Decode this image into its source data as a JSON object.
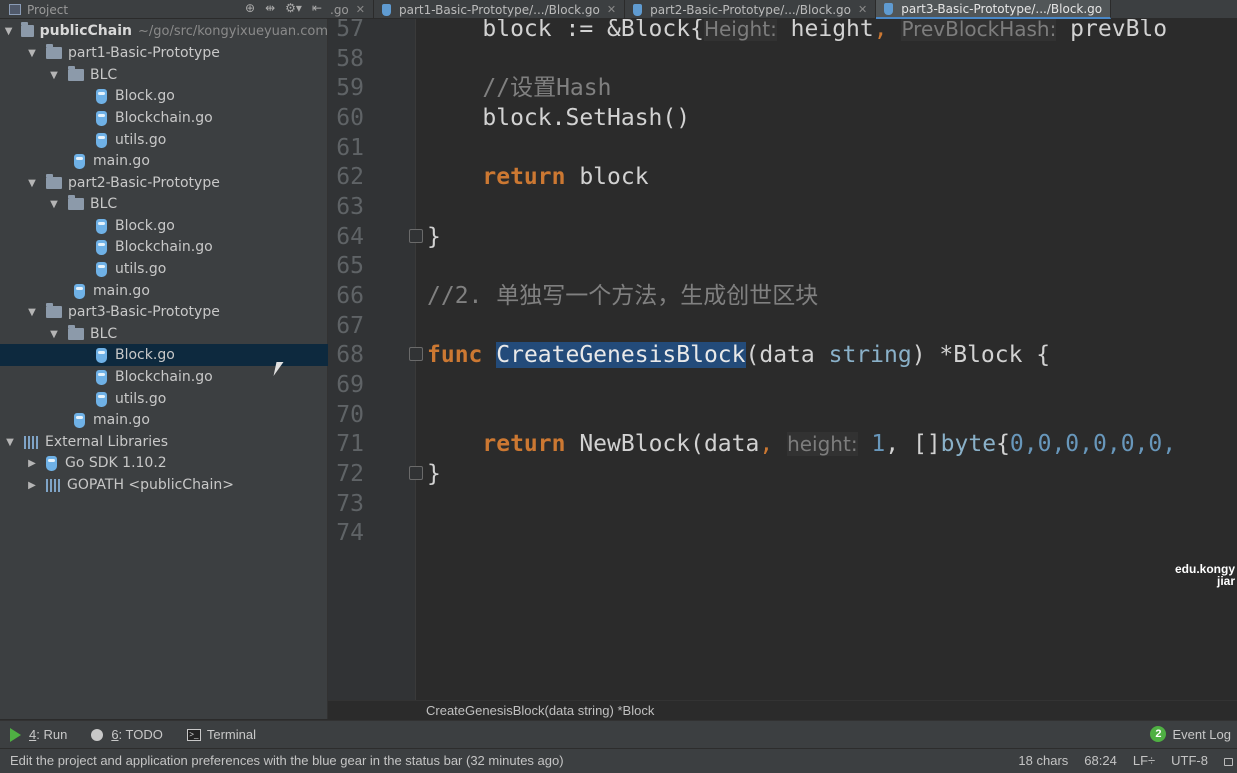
{
  "project_toolbar": {
    "title": "Project"
  },
  "tabs": [
    {
      "label": ".go",
      "partial": true,
      "closable": true
    },
    {
      "label": "part1-Basic-Prototype/.../Block.go",
      "closable": true
    },
    {
      "label": "part2-Basic-Prototype/.../Block.go",
      "closable": true
    },
    {
      "label": "part3-Basic-Prototype/.../Block.go",
      "closable": false,
      "active": true
    }
  ],
  "tree": {
    "root": {
      "label": "publicChain",
      "path": "~/go/src/kongyixueyuan.com"
    },
    "items": [
      {
        "label": "part1-Basic-Prototype"
      },
      {
        "label": "BLC"
      },
      {
        "label": "Block.go"
      },
      {
        "label": "Blockchain.go"
      },
      {
        "label": "utils.go"
      },
      {
        "label": "main.go"
      },
      {
        "label": "part2-Basic-Prototype"
      },
      {
        "label": "BLC"
      },
      {
        "label": "Block.go"
      },
      {
        "label": "Blockchain.go"
      },
      {
        "label": "utils.go"
      },
      {
        "label": "main.go"
      },
      {
        "label": "part3-Basic-Prototype"
      },
      {
        "label": "BLC"
      },
      {
        "label": "Block.go"
      },
      {
        "label": "Blockchain.go"
      },
      {
        "label": "utils.go"
      },
      {
        "label": "main.go"
      },
      {
        "label": "External Libraries"
      },
      {
        "label": "Go SDK 1.10.2"
      },
      {
        "label": "GOPATH <publicChain>"
      }
    ]
  },
  "editor": {
    "line_numbers": [
      "57",
      "58",
      "59",
      "60",
      "61",
      "62",
      "63",
      "64",
      "65",
      "66",
      "67",
      "68",
      "69",
      "70",
      "71",
      "72",
      "73",
      "74"
    ],
    "code": {
      "l57_a": "    block := &Block{",
      "l57_hint1": "Height:",
      "l57_b": " height",
      "l57_comma": ",",
      "l57_hint2": "PrevBlockHash:",
      "l57_c": " prevBlo",
      "l59": "    //设置Hash",
      "l60": "    block.SetHash()",
      "l62_kw": "    return",
      "l62_rest": " block",
      "l64": "}",
      "l66": "//2. 单独写一个方法，生成创世区块",
      "l68_kw": "func",
      "l68_name": "CreateGenesisBlock",
      "l68_a": "(data ",
      "l68_type": "string",
      "l68_b": ") *Block {",
      "l71_kw": "    return",
      "l71_a": " NewBlock(data",
      "l71_comma": ",",
      "l71_hint": "height:",
      "l71_num": " 1",
      "l71_b": ", []",
      "l71_type": "byte",
      "l71_c": "{",
      "l71_nums": "0,0,0,0,0,0,",
      "l72": "}"
    },
    "breadcrumb": "CreateGenesisBlock(data string) *Block",
    "watermark_line1": "edu.kongy",
    "watermark_line2": "jiar"
  },
  "toolwindows": {
    "run_num": "4",
    "run_label": ": Run",
    "todo_num": "6",
    "todo_label": ": TODO",
    "terminal_label": "Terminal",
    "event_count": "2",
    "event_label": "Event Log"
  },
  "status": {
    "message": "Edit the project and application preferences with the blue gear in the status bar (32 minutes ago)",
    "chars": "18 chars",
    "position": "68:24",
    "line_sep": "LF÷",
    "encoding": "UTF-8"
  }
}
